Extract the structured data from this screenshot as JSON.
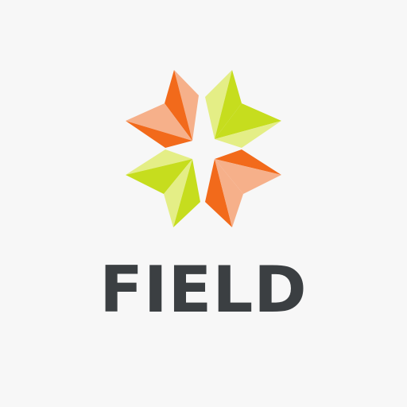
{
  "brand": {
    "name": "FIELD",
    "icon": "field-star-logo-icon"
  },
  "colors": {
    "background": "#f7f7f7",
    "wordmark": "#3b3f42",
    "orange_dark": "#f26a1b",
    "orange_light": "#f6b08a",
    "lime_dark": "#c6dd1e",
    "lime_light": "#e4ee86"
  }
}
